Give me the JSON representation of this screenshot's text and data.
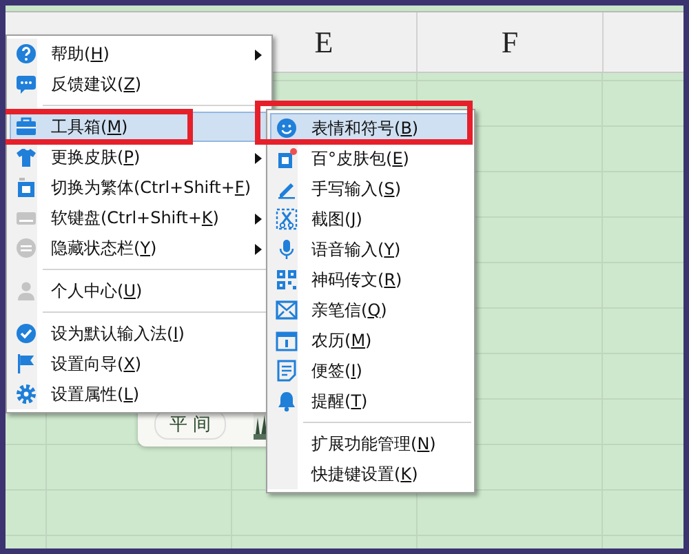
{
  "sheet": {
    "columns": [
      "E",
      "F"
    ],
    "card": {
      "text": "平 间"
    }
  },
  "main_menu": {
    "items": [
      {
        "kind": "item",
        "before": "帮助(",
        "key": "H",
        "after": ")",
        "submenu": true,
        "selected": false,
        "marked": false
      },
      {
        "kind": "item",
        "before": "反馈建议(",
        "key": "Z",
        "after": ")",
        "submenu": false,
        "selected": false,
        "marked": false
      },
      {
        "kind": "separator"
      },
      {
        "kind": "item",
        "before": "工具箱(",
        "key": "M",
        "after": ")",
        "submenu": false,
        "selected": true,
        "marked": true
      },
      {
        "kind": "item",
        "before": "更换皮肤(",
        "key": "P",
        "after": ")",
        "submenu": true,
        "selected": false,
        "marked": false
      },
      {
        "kind": "item",
        "before": "切换为繁体(Ctrl+Shift+",
        "key": "F",
        "after": ")",
        "submenu": false,
        "selected": false,
        "marked": false
      },
      {
        "kind": "item",
        "before": "软键盘(Ctrl+Shift+",
        "key": "K",
        "after": ")",
        "submenu": true,
        "selected": false,
        "marked": false
      },
      {
        "kind": "item",
        "before": "隐藏状态栏(",
        "key": "Y",
        "after": ")",
        "submenu": true,
        "selected": false,
        "marked": false
      },
      {
        "kind": "separator"
      },
      {
        "kind": "item",
        "before": "个人中心(",
        "key": "U",
        "after": ")",
        "submenu": false,
        "selected": false,
        "marked": false
      },
      {
        "kind": "separator"
      },
      {
        "kind": "item",
        "before": "设为默认输入法(",
        "key": "I",
        "after": ")",
        "submenu": false,
        "selected": false,
        "marked": false
      },
      {
        "kind": "item",
        "before": "设置向导(",
        "key": "X",
        "after": ")",
        "submenu": false,
        "selected": false,
        "marked": false
      },
      {
        "kind": "item",
        "before": "设置属性(",
        "key": "L",
        "after": ")",
        "submenu": false,
        "selected": false,
        "marked": false
      }
    ]
  },
  "toolbox_menu": {
    "items": [
      {
        "kind": "item",
        "before": "表情和符号(",
        "key": "B",
        "after": ")",
        "submenu": false,
        "selected": true,
        "marked": true
      },
      {
        "kind": "item",
        "before": "百°皮肤包(",
        "key": "E",
        "after": ")",
        "submenu": false,
        "selected": false,
        "marked": false
      },
      {
        "kind": "item",
        "before": "手写输入(",
        "key": "S",
        "after": ")",
        "submenu": false,
        "selected": false,
        "marked": false
      },
      {
        "kind": "item",
        "before": "截图(",
        "key": "J",
        "after": ")",
        "submenu": false,
        "selected": false,
        "marked": false
      },
      {
        "kind": "item",
        "before": "语音输入(",
        "key": "Y",
        "after": ")",
        "submenu": false,
        "selected": false,
        "marked": false
      },
      {
        "kind": "item",
        "before": "神码传文(",
        "key": "R",
        "after": ")",
        "submenu": false,
        "selected": false,
        "marked": false
      },
      {
        "kind": "item",
        "before": "亲笔信(",
        "key": "Q",
        "after": ")",
        "submenu": false,
        "selected": false,
        "marked": false
      },
      {
        "kind": "item",
        "before": "农历(",
        "key": "M",
        "after": ")",
        "submenu": false,
        "selected": false,
        "marked": false
      },
      {
        "kind": "item",
        "before": "便签(",
        "key": "I",
        "after": ")",
        "submenu": false,
        "selected": false,
        "marked": false
      },
      {
        "kind": "item",
        "before": "提醒(",
        "key": "T",
        "after": ")",
        "submenu": false,
        "selected": false,
        "marked": false
      },
      {
        "kind": "separator"
      },
      {
        "kind": "item",
        "before": "扩展功能管理(",
        "key": "N",
        "after": ")",
        "submenu": false,
        "selected": false,
        "marked": false
      },
      {
        "kind": "item",
        "before": "快捷键设置(",
        "key": "K",
        "after": ")",
        "submenu": false,
        "selected": false,
        "marked": false
      }
    ]
  }
}
